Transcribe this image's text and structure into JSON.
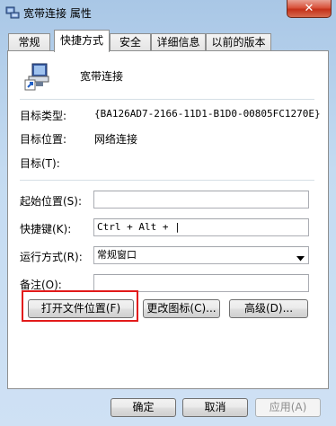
{
  "window": {
    "title": "宽带连接 属性",
    "close_glyph": "✕"
  },
  "tabs": [
    {
      "label": "常规"
    },
    {
      "label": "快捷方式"
    },
    {
      "label": "安全"
    },
    {
      "label": "详细信息"
    },
    {
      "label": "以前的版本"
    }
  ],
  "shortcut": {
    "name": "宽带连接",
    "target_type_label": "目标类型:",
    "target_type_value": "{BA126AD7-2166-11D1-B1D0-00805FC1270E}",
    "target_location_label": "目标位置:",
    "target_location_value": "网络连接",
    "target_label": "目标(T):",
    "start_in_label": "起始位置(S):",
    "start_in_value": "",
    "hotkey_label": "快捷键(K):",
    "hotkey_value": "Ctrl + Alt + |",
    "run_label": "运行方式(R):",
    "run_value": "常规窗口",
    "comment_label": "备注(O):",
    "comment_value": ""
  },
  "buttons": {
    "open_location": "打开文件位置(F)",
    "change_icon": "更改图标(C)...",
    "advanced": "高级(D)...",
    "ok": "确定",
    "cancel": "取消",
    "apply": "应用(A)"
  },
  "icons": {
    "app": "network-connection-icon",
    "shortcut": "broadband-connection-icon",
    "dropdown": "chevron-down-icon"
  }
}
